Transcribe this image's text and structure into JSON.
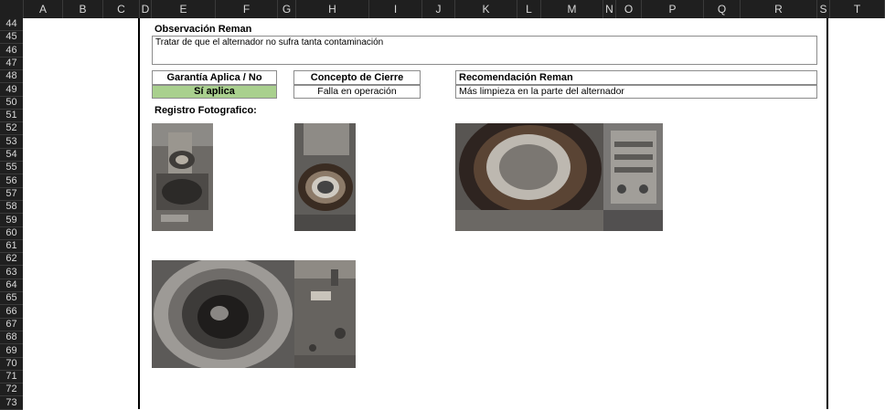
{
  "columns": [
    "A",
    "B",
    "C",
    "D",
    "E",
    "F",
    "G",
    "H",
    "I",
    "J",
    "K",
    "L",
    "M",
    "N",
    "O",
    "P",
    "Q",
    "R",
    "S",
    "T"
  ],
  "rows": [
    "44",
    "45",
    "46",
    "47",
    "48",
    "49",
    "50",
    "51",
    "52",
    "53",
    "54",
    "55",
    "56",
    "57",
    "58",
    "59",
    "60",
    "61",
    "62",
    "63",
    "64",
    "65",
    "66",
    "67",
    "68",
    "69",
    "70",
    "71",
    "72",
    "73"
  ],
  "observacion": {
    "title": "Observación Reman",
    "text": "Tratar de que el alternador no sufra tanta contaminación"
  },
  "garantia": {
    "header": "Garantía Aplica / No aplica",
    "value": "Sí aplica",
    "value_bg": "#a9d08e"
  },
  "concepto": {
    "header": "Concepto de Cierre",
    "value": "Falla en operación"
  },
  "recomendacion": {
    "header": "Recomendación Reman",
    "value": "Más limpieza en la parte del alternador"
  },
  "registro": {
    "title": "Registro Fotografico:"
  },
  "photos": [
    {
      "name": "photo-alternator-rotor",
      "icon": "photo"
    },
    {
      "name": "photo-stator-ring",
      "icon": "photo"
    },
    {
      "name": "photo-stator-closeup",
      "icon": "photo"
    },
    {
      "name": "photo-alternator-housing",
      "icon": "photo"
    },
    {
      "name": "photo-housing-interior",
      "icon": "photo"
    },
    {
      "name": "photo-workbench-parts",
      "icon": "photo"
    }
  ]
}
